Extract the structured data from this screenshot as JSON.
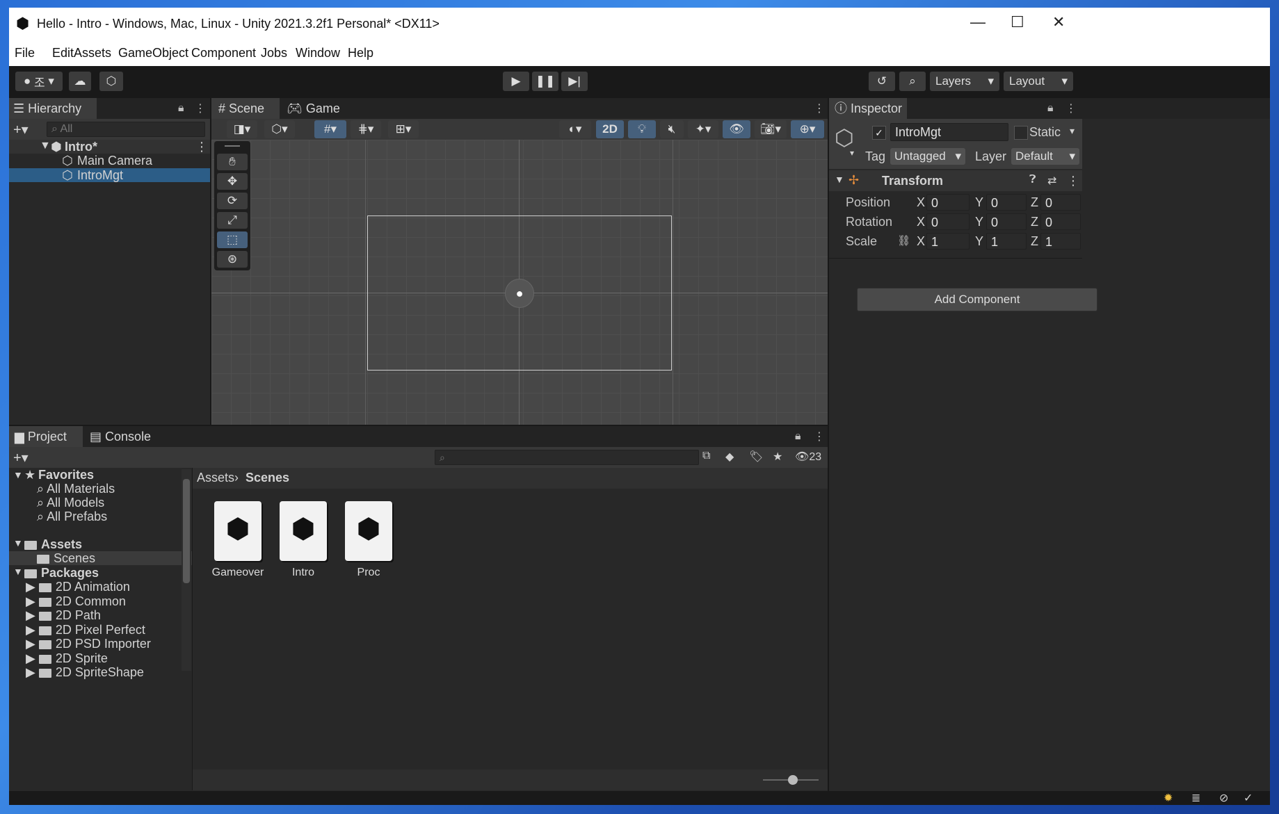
{
  "window": {
    "title": "Hello - Intro - Windows, Mac, Linux - Unity 2021.3.2f1 Personal* <DX11>"
  },
  "menu": [
    "File",
    "Edit",
    "Assets",
    "GameObject",
    "Component",
    "Jobs",
    "Window",
    "Help"
  ],
  "toolbar": {
    "account_label": "조",
    "layers_label": "Layers",
    "layout_label": "Layout"
  },
  "hierarchy": {
    "tab": "Hierarchy",
    "search_placeholder": "All",
    "scene": "Intro*",
    "items": [
      "Main Camera",
      "IntroMgt"
    ]
  },
  "scene_view": {
    "tabs": [
      "Scene",
      "Game"
    ],
    "mode_2d": "2D"
  },
  "inspector": {
    "tab": "Inspector",
    "object_name": "IntroMgt",
    "static_label": "Static",
    "tag_label": "Tag",
    "tag_value": "Untagged",
    "layer_label": "Layer",
    "layer_value": "Default",
    "component": "Transform",
    "rows": [
      {
        "label": "Position",
        "x": "0",
        "y": "0",
        "z": "0"
      },
      {
        "label": "Rotation",
        "x": "0",
        "y": "0",
        "z": "0"
      },
      {
        "label": "Scale",
        "x": "1",
        "y": "1",
        "z": "1"
      }
    ],
    "axis": [
      "X",
      "Y",
      "Z"
    ],
    "add_component": "Add Component"
  },
  "project": {
    "tabs": [
      "Project",
      "Console"
    ],
    "hidden_count": "23",
    "favorites": {
      "label": "Favorites",
      "items": [
        "All Materials",
        "All Models",
        "All Prefabs"
      ]
    },
    "assets": {
      "label": "Assets",
      "items": [
        "Scenes"
      ]
    },
    "packages": {
      "label": "Packages",
      "items": [
        "2D Animation",
        "2D Common",
        "2D Path",
        "2D Pixel Perfect",
        "2D PSD Importer",
        "2D Sprite",
        "2D SpriteShape"
      ]
    },
    "breadcrumb": [
      "Assets",
      "Scenes"
    ],
    "files": [
      "Gameover",
      "Intro",
      "Proc"
    ]
  }
}
